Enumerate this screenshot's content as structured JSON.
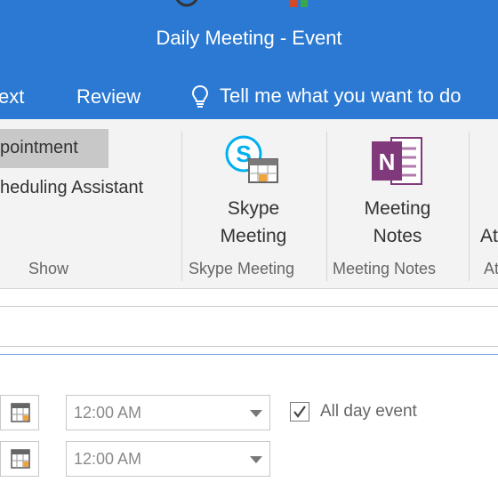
{
  "window": {
    "title": "Daily Meeting  -  Event"
  },
  "tabs": [
    {
      "label": "ext"
    },
    {
      "label": "Review"
    }
  ],
  "tell_me": {
    "label": "Tell me what you want to do"
  },
  "ribbon": {
    "show": {
      "appointment_label": "pointment",
      "scheduling_label": "heduling Assistant",
      "group_label": "Show"
    },
    "skype": {
      "line1": "Skype",
      "line2": "Meeting",
      "group_label": "Skype Meeting"
    },
    "notes": {
      "line1": "Meeting",
      "line2": "Notes",
      "group_label": "Meeting Notes"
    },
    "cut_label": "At",
    "cut_group": "At"
  },
  "start": {
    "time": "12:00 AM"
  },
  "end": {
    "time": "12:00 AM"
  },
  "all_day": {
    "label": "All day event",
    "checked": true
  },
  "colors": {
    "brand_blue": "#2b79d2",
    "skype_blue": "#00aff0",
    "onenote_purple": "#80397b"
  }
}
